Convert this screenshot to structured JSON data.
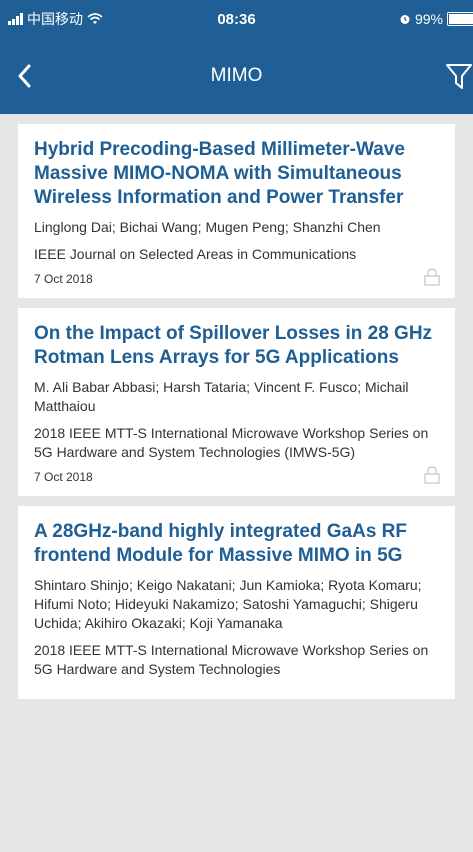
{
  "status_bar": {
    "carrier": "中国移动",
    "time": "08:36",
    "battery": "99%",
    "battery_level": 0.99
  },
  "nav": {
    "title": "MIMO"
  },
  "articles": [
    {
      "title": "Hybrid Precoding-Based Millimeter-Wave Massive MIMO-NOMA with Simultaneous Wireless Information and Power Transfer",
      "authors": "Linglong Dai; Bichai Wang; Mugen Peng; Shanzhi Chen",
      "publication": "IEEE Journal on Selected Areas in Communications",
      "date": "7 Oct 2018",
      "locked": true
    },
    {
      "title": "On the Impact of Spillover Losses in 28 GHz Rotman Lens Arrays for 5G Applications",
      "authors": "M. Ali Babar Abbasi; Harsh Tataria; Vincent F. Fusco; Michail Matthaiou",
      "publication": "2018 IEEE MTT-S International Microwave Workshop Series on 5G Hardware and System Technologies (IMWS-5G)",
      "date": "7 Oct 2018",
      "locked": true
    },
    {
      "title": "A 28GHz-band highly integrated GaAs RF frontend Module for Massive MIMO in 5G",
      "authors": "Shintaro Shinjo; Keigo Nakatani; Jun Kamioka; Ryota Komaru; Hifumi Noto; Hideyuki Nakamizo; Satoshi Yamaguchi; Shigeru Uchida; Akihiro Okazaki; Koji Yamanaka",
      "publication": "2018 IEEE MTT-S International Microwave Workshop Series on 5G Hardware and System Technologies",
      "date": "",
      "locked": false
    }
  ]
}
